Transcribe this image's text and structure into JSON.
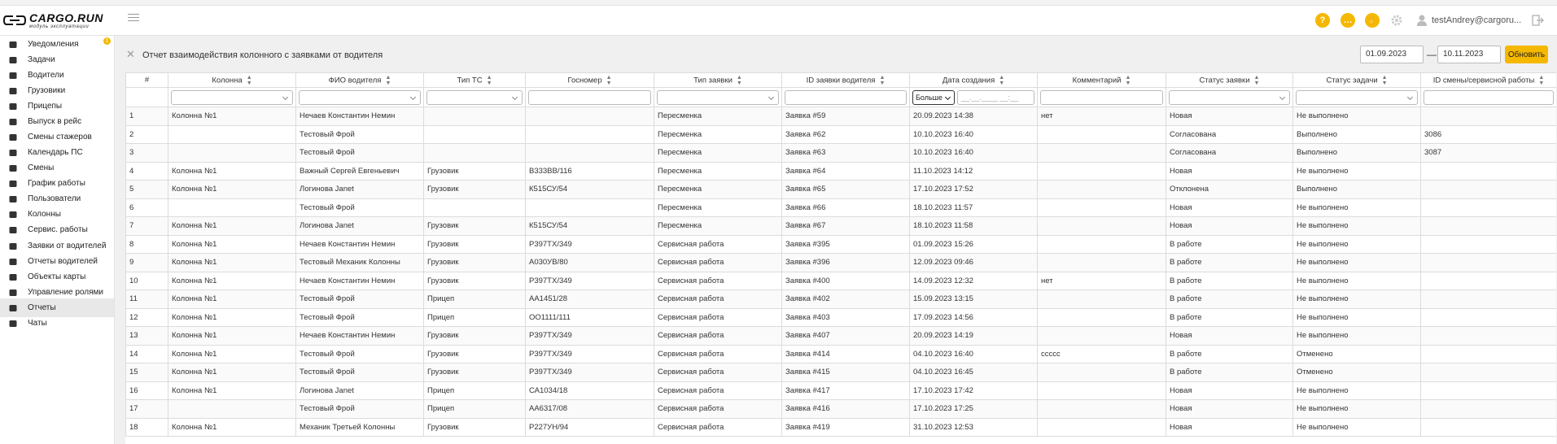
{
  "app": {
    "logo_title": "CARGO.RUN",
    "logo_subtitle": "модуль эксплуатации",
    "accent_color": "#f5b800",
    "user_name": "testAndrey@cargoru..."
  },
  "header_icons": [
    {
      "name": "help-icon",
      "glyph": "?"
    },
    {
      "name": "chat-bubble-icon",
      "glyph": "…"
    },
    {
      "name": "hand-icon",
      "glyph": "✋"
    }
  ],
  "sidebar": {
    "items": [
      {
        "label": "Уведомления",
        "icon": "bell-icon",
        "badge": "1"
      },
      {
        "label": "Задачи",
        "icon": "list-icon"
      },
      {
        "label": "Водители",
        "icon": "steering-wheel-icon"
      },
      {
        "label": "Грузовики",
        "icon": "truck-icon"
      },
      {
        "label": "Прицепы",
        "icon": "trailer-icon"
      },
      {
        "label": "Выпуск в рейс",
        "icon": "driver-release-icon"
      },
      {
        "label": "Смены стажеров",
        "icon": "trainee-icon"
      },
      {
        "label": "Календарь ПС",
        "icon": "calendar-icon"
      },
      {
        "label": "Смены",
        "icon": "shifts-icon"
      },
      {
        "label": "График работы",
        "icon": "chart-icon"
      },
      {
        "label": "Пользователи",
        "icon": "users-icon"
      },
      {
        "label": "Колонны",
        "icon": "garage-icon"
      },
      {
        "label": "Сервис. работы",
        "icon": "service-icon"
      },
      {
        "label": "Заявки от водителей",
        "icon": "pen-icon"
      },
      {
        "label": "Отчеты водителей",
        "icon": "report-icon"
      },
      {
        "label": "Объекты карты",
        "icon": "map-objects-icon"
      },
      {
        "label": "Управление ролями",
        "icon": "roles-icon"
      },
      {
        "label": "Отчеты",
        "icon": "clipboard-icon",
        "active": true
      },
      {
        "label": "Чаты",
        "icon": "chat-icon"
      }
    ]
  },
  "page": {
    "title": "Отчет взаимодействия колонного с заявками от водителя",
    "date_from": "01.09.2023",
    "date_sep": "—",
    "date_to": "10.11.2023",
    "refresh_label": "Обновить"
  },
  "table": {
    "columns": [
      "#",
      "Колонна",
      "ФИО водителя",
      "Тип ТС",
      "Госномер",
      "Тип заявки",
      "ID заявки водителя",
      "Дата создания",
      "Комментарий",
      "Статус заявки",
      "Статус задачи",
      "ID смены/сервисной работы"
    ],
    "filter_compare": "Больше",
    "filter_date_placeholder": "__.__.____ __:__",
    "rows": [
      [
        "1",
        "Колонна №1",
        "Нечаев Константин Немин",
        "",
        "",
        "Пересменка",
        "Заявка #59",
        "20.09.2023 14:38",
        "нет",
        "Новая",
        "Не выполнено",
        ""
      ],
      [
        "2",
        "",
        "Тестовый Фрой",
        "",
        "",
        "Пересменка",
        "Заявка #62",
        "10.10.2023 16:40",
        "",
        "Согласована",
        "Выполнено",
        "3086"
      ],
      [
        "3",
        "",
        "Тестовый Фрой",
        "",
        "",
        "Пересменка",
        "Заявка #63",
        "10.10.2023 16:40",
        "",
        "Согласована",
        "Выполнено",
        "3087"
      ],
      [
        "4",
        "Колонна №1",
        "Важный Сергей Евгеньевич",
        "Грузовик",
        "В333ВВ/116",
        "Пересменка",
        "Заявка #64",
        "11.10.2023 14:12",
        "",
        "Новая",
        "Не выполнено",
        ""
      ],
      [
        "5",
        "Колонна №1",
        "Логинова Janet",
        "Грузовик",
        "К515СУ/54",
        "Пересменка",
        "Заявка #65",
        "17.10.2023 17:52",
        "",
        "Отклонена",
        "Выполнено",
        ""
      ],
      [
        "6",
        "",
        "Тестовый Фрой",
        "",
        "",
        "Пересменка",
        "Заявка #66",
        "18.10.2023 11:57",
        "",
        "Новая",
        "Не выполнено",
        ""
      ],
      [
        "7",
        "Колонна №1",
        "Логинова Janet",
        "Грузовик",
        "К515СУ/54",
        "Пересменка",
        "Заявка #67",
        "18.10.2023 11:58",
        "",
        "Новая",
        "Не выполнено",
        ""
      ],
      [
        "8",
        "Колонна №1",
        "Нечаев Константин Немин",
        "Грузовик",
        "Р397ТХ/349",
        "Сервисная работа",
        "Заявка #395",
        "01.09.2023 15:26",
        "",
        "В работе",
        "Не выполнено",
        ""
      ],
      [
        "9",
        "Колонна №1",
        "Тестовый Механик Колонны",
        "Грузовик",
        "А030УВ/80",
        "Сервисная работа",
        "Заявка #396",
        "12.09.2023 09:46",
        "",
        "В работе",
        "Не выполнено",
        ""
      ],
      [
        "10",
        "Колонна №1",
        "Нечаев Константин Немин",
        "Грузовик",
        "Р397ТХ/349",
        "Сервисная работа",
        "Заявка #400",
        "14.09.2023 12:32",
        "нет",
        "В работе",
        "Не выполнено",
        ""
      ],
      [
        "11",
        "Колонна №1",
        "Тестовый Фрой",
        "Прицеп",
        "АА1451/28",
        "Сервисная работа",
        "Заявка #402",
        "15.09.2023 13:15",
        "",
        "В работе",
        "Не выполнено",
        ""
      ],
      [
        "12",
        "Колонна №1",
        "Тестовый Фрой",
        "Прицеп",
        "ОО1111/111",
        "Сервисная работа",
        "Заявка #403",
        "17.09.2023 14:56",
        "",
        "В работе",
        "Не выполнено",
        ""
      ],
      [
        "13",
        "Колонна №1",
        "Нечаев Константин Немин",
        "Грузовик",
        "Р397ТХ/349",
        "Сервисная работа",
        "Заявка #407",
        "20.09.2023 14:19",
        "",
        "Новая",
        "Не выполнено",
        ""
      ],
      [
        "14",
        "Колонна №1",
        "Тестовый Фрой",
        "Грузовик",
        "Р397ТХ/349",
        "Сервисная работа",
        "Заявка #414",
        "04.10.2023 16:40",
        "сcccc",
        "В работе",
        "Отменено",
        ""
      ],
      [
        "15",
        "Колонна №1",
        "Тестовый Фрой",
        "Грузовик",
        "Р397ТХ/349",
        "Сервисная работа",
        "Заявка #415",
        "04.10.2023 16:45",
        "",
        "В работе",
        "Отменено",
        ""
      ],
      [
        "16",
        "Колонна №1",
        "Логинова Janet",
        "Прицеп",
        "СА1034/18",
        "Сервисная работа",
        "Заявка #417",
        "17.10.2023 17:42",
        "",
        "Новая",
        "Не выполнено",
        ""
      ],
      [
        "17",
        "",
        "Тестовый Фрой",
        "Прицеп",
        "АА6317/08",
        "Сервисная работа",
        "Заявка #416",
        "17.10.2023 17:25",
        "",
        "Новая",
        "Не выполнено",
        ""
      ],
      [
        "18",
        "Колонна №1",
        "Механик Третьей Колонны",
        "Грузовик",
        "Р227УН/94",
        "Сервисная работа",
        "Заявка #419",
        "31.10.2023 12:53",
        "",
        "Новая",
        "Не выполнено",
        ""
      ]
    ]
  }
}
